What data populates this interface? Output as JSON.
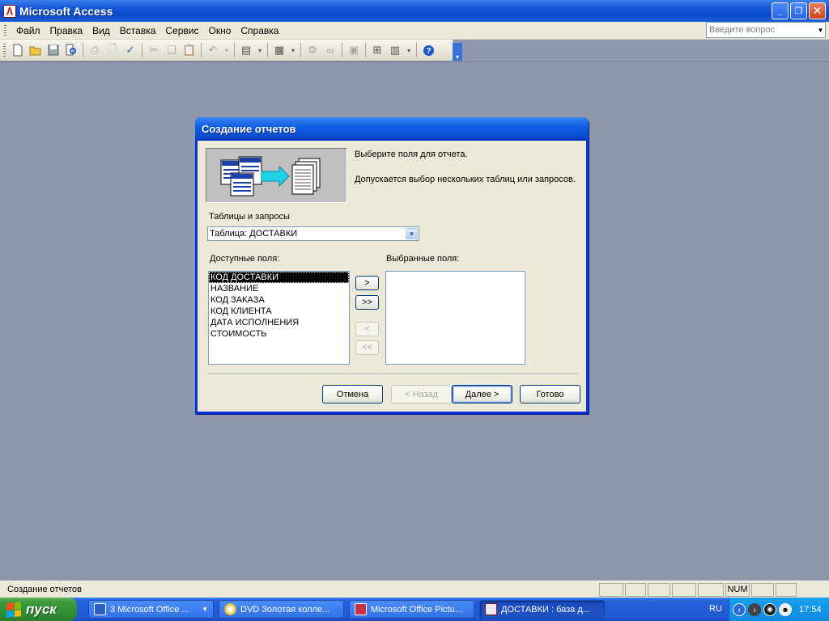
{
  "window": {
    "title": "Microsoft Access",
    "buttons": {
      "minimize": "_",
      "restore": "❐",
      "close": "✕"
    }
  },
  "menubar": {
    "items": [
      "Файл",
      "Правка",
      "Вид",
      "Вставка",
      "Сервис",
      "Окно",
      "Справка"
    ],
    "ask_placeholder": "Введите вопрос"
  },
  "toolbar": {
    "icons": [
      "new-icon",
      "open-icon",
      "save-icon",
      "file-search-icon",
      "print-icon",
      "print-preview-icon",
      "spelling-icon",
      "cut-icon",
      "copy-icon",
      "paste-icon",
      "undo-icon",
      "office-links-icon",
      "analyze-icon",
      "code-icon",
      "script-icon",
      "properties-icon",
      "relationships-icon",
      "new-object-icon",
      "help-icon"
    ]
  },
  "dialog": {
    "title": "Создание отчетов",
    "prompt": "Выберите поля для отчета.",
    "note": "Допускается выбор нескольких таблиц или запросов.",
    "tables_label": "Таблицы и запросы",
    "tables_value": "Таблица: ДОСТАВКИ",
    "available_label": "Доступные поля:",
    "selected_label": "Выбранные поля:",
    "available_fields": [
      "КОД ДОСТАВКИ",
      "НАЗВАНИЕ",
      "КОД ЗАКАЗА",
      "КОД КЛИЕНТА",
      "ДАТА ИСПОЛНЕНИЯ",
      "СТОИМОСТЬ"
    ],
    "selected_fields": [],
    "move": {
      "one": ">",
      "all": ">>",
      "back_one": "<",
      "back_all": "<<"
    },
    "buttons": {
      "cancel": "Отмена",
      "back": "< Назад",
      "next": "Далее >",
      "finish": "Готово"
    }
  },
  "statusbar": {
    "text": "Создание отчетов",
    "num": "NUM"
  },
  "taskbar": {
    "start_label": "пуск",
    "tasks": [
      {
        "label": "3 Microsoft Office ..."
      },
      {
        "label": "DVD  Золотая колле..."
      },
      {
        "label": "Microsoft Office Pictu..."
      },
      {
        "label": "ДОСТАВКИ : база д..."
      }
    ],
    "lang": "RU",
    "clock": "17:54"
  }
}
